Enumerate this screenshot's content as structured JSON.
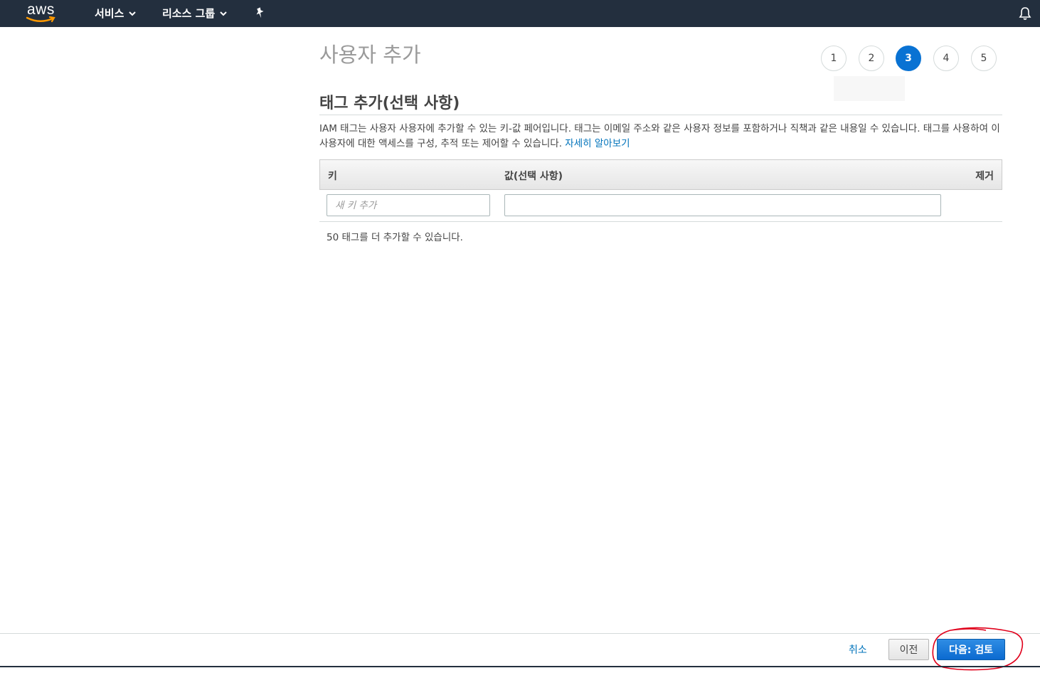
{
  "topnav": {
    "logo_text": "aws",
    "items": [
      {
        "label": "서비스"
      },
      {
        "label": "리소스 그룹"
      }
    ]
  },
  "page": {
    "title": "사용자 추가",
    "steps": [
      "1",
      "2",
      "3",
      "4",
      "5"
    ],
    "active_step": "3",
    "section_title": "태그 추가(선택 사항)",
    "description": "IAM 태그는 사용자 사용자에 추가할 수 있는 키-값 페어입니다. 태그는 이메일 주소와 같은 사용자 정보를 포함하거나 직책과 같은 내용일 수 있습니다. 태그를 사용하여 이 사용자에 대한 액세스를 구성, 추적 또는 제어할 수 있습니다.",
    "learn_more": "자세히 알아보기"
  },
  "table": {
    "headers": {
      "key": "키",
      "value": "값(선택 사항)",
      "remove": "제거"
    },
    "key_placeholder": "새 키 추가",
    "value": "",
    "remaining": "50 태그를 더 추가할 수 있습니다."
  },
  "footer": {
    "cancel": "취소",
    "previous": "이전",
    "next": "다음: 검토"
  },
  "colors": {
    "nav_bg": "#232f3e",
    "accent": "#0972d3",
    "link": "#0073bb",
    "annotation": "#e0001b"
  }
}
